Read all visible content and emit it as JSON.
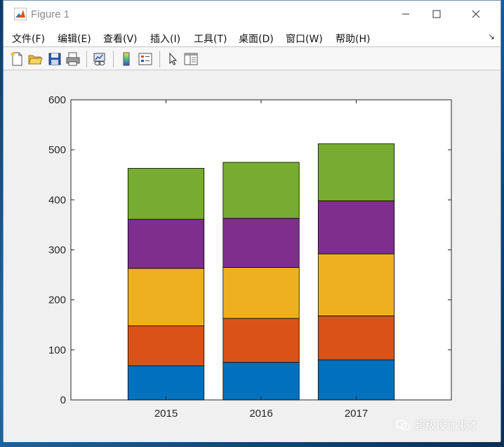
{
  "window": {
    "title": "Figure 1",
    "controls": [
      "minimize-icon",
      "maximize-icon",
      "close-icon"
    ]
  },
  "menu": {
    "items": [
      "文件(F)",
      "编辑(E)",
      "查看(V)",
      "插入(I)",
      "工具(T)",
      "桌面(D)",
      "窗口(W)",
      "帮助(H)"
    ]
  },
  "toolbar": {
    "icons": [
      "new-figure-icon",
      "open-file-icon",
      "save-icon",
      "print-icon",
      "link-plot-icon",
      "colorbar-icon",
      "legend-icon",
      "pointer-icon",
      "property-editor-icon"
    ]
  },
  "chart_data": {
    "type": "bar",
    "stacked": true,
    "categories": [
      "2015",
      "2016",
      "2017"
    ],
    "series": [
      {
        "color": "#0072BD",
        "values": [
          68,
          75,
          80
        ]
      },
      {
        "color": "#D95319",
        "values": [
          80,
          88,
          88
        ]
      },
      {
        "color": "#EDB120",
        "values": [
          115,
          102,
          124
        ]
      },
      {
        "color": "#7E2F8E",
        "values": [
          98,
          98,
          106
        ]
      },
      {
        "color": "#77AC30",
        "values": [
          102,
          112,
          114
        ]
      }
    ],
    "ylim": [
      0,
      600
    ],
    "yticks": [
      "0",
      "100",
      "200",
      "300",
      "400",
      "500",
      "600"
    ],
    "grid": false
  },
  "watermark": {
    "text": "超级设计鬼才"
  }
}
